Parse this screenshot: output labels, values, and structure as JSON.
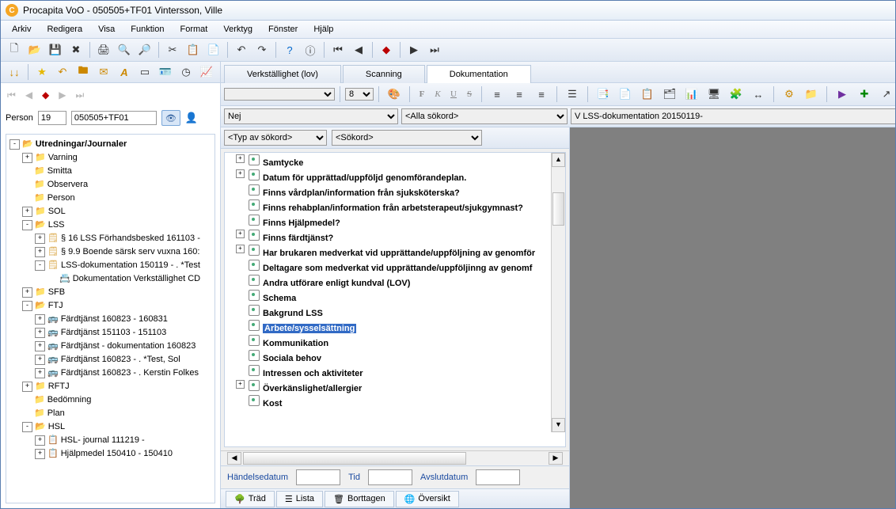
{
  "title": "Procapita VoO - 050505+TF01 Vintersson, Ville",
  "menu": [
    "Arkiv",
    "Redigera",
    "Visa",
    "Funktion",
    "Format",
    "Verktyg",
    "Fönster",
    "Hjälp"
  ],
  "person": {
    "label": "Person",
    "num": "19",
    "id": "050505+TF01"
  },
  "tree": {
    "root": "Utredningar/Journaler",
    "items": [
      {
        "l": "Varning",
        "exp": "+",
        "ic": "📁"
      },
      {
        "l": "Smitta",
        "exp": "",
        "ic": "📁"
      },
      {
        "l": "Observera",
        "exp": "",
        "ic": "📁"
      },
      {
        "l": "Person",
        "exp": "",
        "ic": "📁"
      },
      {
        "l": "SOL",
        "exp": "+",
        "ic": "📁"
      },
      {
        "l": "LSS",
        "exp": "-",
        "ic": "📂",
        "children": [
          {
            "l": "§ 16 LSS Förhandsbesked 161103 -",
            "exp": "+",
            "ic": "🗒"
          },
          {
            "l": "§ 9.9 Boende särsk serv vuxna 160:",
            "exp": "+",
            "ic": "🗒"
          },
          {
            "l": "LSS-dokumentation 150119 - . *Test",
            "exp": "-",
            "ic": "🗒",
            "children": [
              {
                "l": "Dokumentation Verkställighet CD",
                "ic": "📇"
              }
            ]
          }
        ]
      },
      {
        "l": "SFB",
        "exp": "+",
        "ic": "📁"
      },
      {
        "l": "FTJ",
        "exp": "-",
        "ic": "📂",
        "children": [
          {
            "l": "Färdtjänst 160823 - 160831",
            "exp": "+",
            "ic": "🚌"
          },
          {
            "l": "Färdtjänst 151103 - 151103",
            "exp": "+",
            "ic": "🚌"
          },
          {
            "l": "Färdtjänst - dokumentation 160823",
            "exp": "+",
            "ic": "🚌"
          },
          {
            "l": "Färdtjänst 160823 - . *Test, Sol",
            "exp": "+",
            "ic": "🚌"
          },
          {
            "l": "Färdtjänst 160823 - . Kerstin Folkes",
            "exp": "+",
            "ic": "🚌"
          }
        ]
      },
      {
        "l": "RFTJ",
        "exp": "+",
        "ic": "📁"
      },
      {
        "l": "Bedömning",
        "exp": "",
        "ic": "📁"
      },
      {
        "l": "Plan",
        "exp": "",
        "ic": "📁"
      },
      {
        "l": "HSL",
        "exp": "-",
        "ic": "📂",
        "children": [
          {
            "l": "HSL- journal 111219 -",
            "exp": "+",
            "ic": "📋"
          },
          {
            "l": "Hjälpmedel 150410 - 150410",
            "exp": "+",
            "ic": "📋"
          }
        ]
      }
    ]
  },
  "tabs": [
    "Verkställighet (lov)",
    "Scanning",
    "Dokumentation"
  ],
  "activeTab": 2,
  "rich": {
    "font": "",
    "size": "8"
  },
  "filters": {
    "f1": "Nej",
    "f2": "<Alla sökord>",
    "f3": "V LSS-dokumentation 20150119-",
    "kw1": "<Typ av sökord>",
    "kw2": "<Sökord>"
  },
  "keywords": [
    {
      "t": "Samtycke",
      "exp": "+"
    },
    {
      "t": "Datum för upprättad/uppföljd genomförandeplan.",
      "exp": "+"
    },
    {
      "t": "Finns vårdplan/information från sjuksköterska?"
    },
    {
      "t": "Finns rehabplan/information från arbetsterapeut/sjukgymnast?"
    },
    {
      "t": "Finns Hjälpmedel?"
    },
    {
      "t": "Finns färdtjänst?",
      "exp": "+"
    },
    {
      "t": "Har brukaren medverkat vid upprättande/uppföljning av genomför",
      "exp": "+"
    },
    {
      "t": "Deltagare som medverkat vid upprättande/uppföljinng av genomf"
    },
    {
      "t": "Andra utförare enligt kundval (LOV)"
    },
    {
      "t": "Schema"
    },
    {
      "t": "Bakgrund LSS"
    },
    {
      "t": "Arbete/sysselsättning",
      "sel": true
    },
    {
      "t": "Kommunikation"
    },
    {
      "t": "Sociala behov"
    },
    {
      "t": "Intressen och aktiviteter"
    },
    {
      "t": "Överkänslighet/allergier",
      "exp": "+"
    },
    {
      "t": "Kost"
    }
  ],
  "dates": {
    "l1": "Händelsedatum",
    "l2": "Tid",
    "l3": "Avslutdatum"
  },
  "views": [
    "Träd",
    "Lista",
    "Borttagen",
    "Översikt"
  ]
}
